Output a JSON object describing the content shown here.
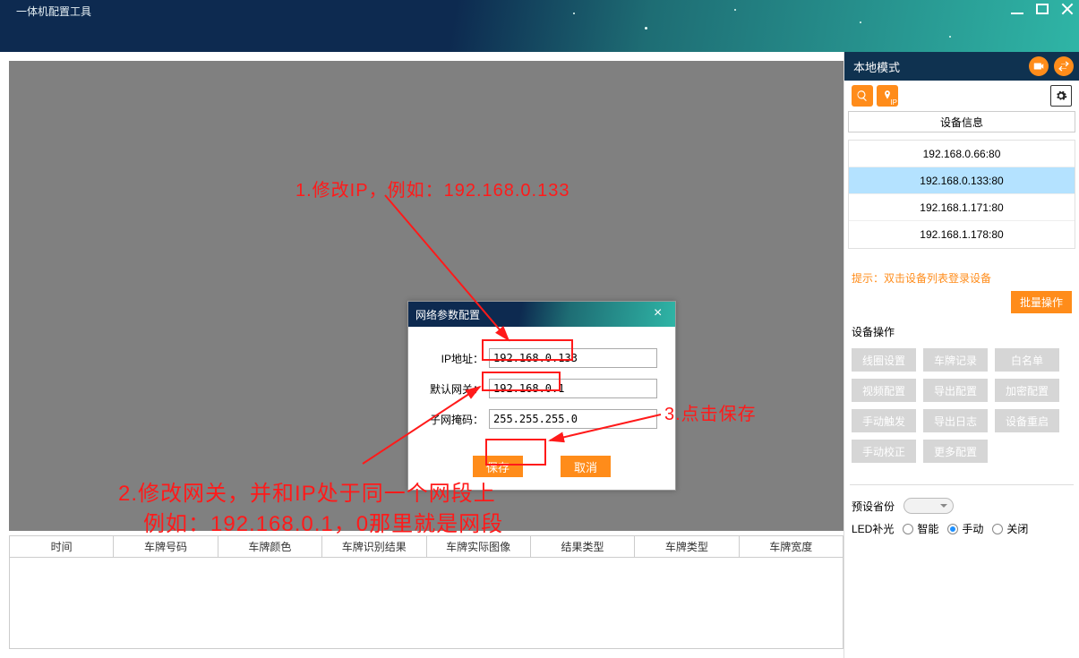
{
  "window": {
    "title": "一体机配置工具"
  },
  "right": {
    "mode_label": "本地模式",
    "device_header": "设备信息",
    "devices": [
      "192.168.0.66:80",
      "192.168.0.133:80",
      "192.168.1.171:80",
      "192.168.1.178:80"
    ],
    "hint": "提示：双击设备列表登录设备",
    "batch": "批量操作",
    "ops_label": "设备操作",
    "ops": [
      "线圈设置",
      "车牌记录",
      "白名单",
      "视频配置",
      "导出配置",
      "加密配置",
      "手动触发",
      "导出日志",
      "设备重启",
      "手动校正",
      "更多配置"
    ],
    "preset_label": "预设省份",
    "led_label": "LED补光",
    "led_opts": [
      "智能",
      "手动",
      "关闭"
    ]
  },
  "table": {
    "cols": [
      "时间",
      "车牌号码",
      "车牌颜色",
      "车牌识别结果",
      "车牌实际图像",
      "结果类型",
      "车牌类型",
      "车牌宽度"
    ]
  },
  "dialog": {
    "title": "网络参数配置",
    "ip_label": "IP地址：",
    "gw_label": "默认网关：",
    "mask_label": "子网掩码：",
    "ip": "192.168.0.133",
    "gw": "192.168.0.1",
    "mask": "255.255.255.0",
    "save": "保存",
    "cancel": "取消"
  },
  "annotations": {
    "a1": "1.修改IP，例如：192.168.0.133",
    "a2a": "2.修改网关，并和IP处于同一个网段上",
    "a2b": "例如：192.168.0.1，0那里就是网段",
    "a3": "3.点击保存"
  }
}
